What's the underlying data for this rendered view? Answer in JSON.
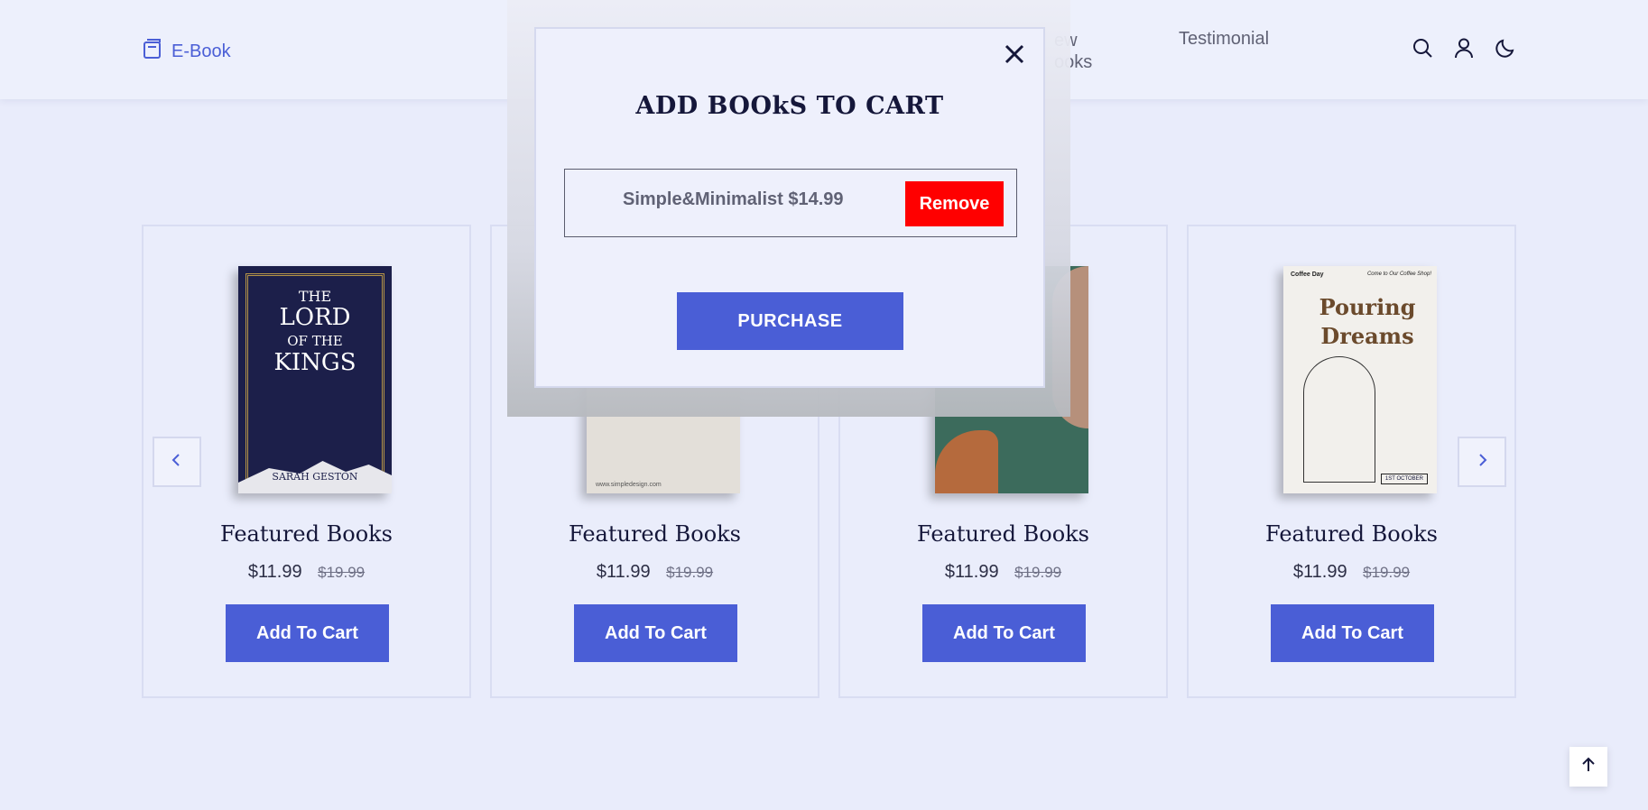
{
  "header": {
    "logo_label": "E-Book",
    "nav_partial_line1": "ew",
    "nav_partial_line2": "ooks",
    "nav_testimonial": "Testimonial",
    "icons": [
      "search-icon",
      "user-icon",
      "moon-icon"
    ]
  },
  "modal": {
    "title": "ADD BOOkS TO CART",
    "item_text": "Simple&Minimalist $14.99",
    "remove_label": "Remove",
    "purchase_label": "PURCHASE"
  },
  "cards": [
    {
      "title": "Featured Books",
      "price": "$11.99",
      "old_price": "$19.99",
      "button": "Add To Cart",
      "cover": {
        "line1": "THE",
        "line2": "LORD",
        "line3": "OF THE",
        "line4": "KINGS",
        "author": "SARAH GESTON"
      }
    },
    {
      "title": "Featured Books",
      "price": "$11.99",
      "old_price": "$19.99",
      "button": "Add To Cart",
      "cover": {
        "url": "www.simpledesign.com"
      }
    },
    {
      "title": "Featured Books",
      "price": "$11.99",
      "old_price": "$19.99",
      "button": "Add To Cart"
    },
    {
      "title": "Featured Books",
      "price": "$11.99",
      "old_price": "$19.99",
      "button": "Add To Cart",
      "cover": {
        "top_left": "Coffee Day",
        "top_right": "Come to Our Coffee Shop!",
        "headline1": "Pouring",
        "headline2": "Dreams",
        "date": "1ST OCTOBER"
      }
    }
  ],
  "colors": {
    "accent": "#4a5ed6",
    "remove": "#ff0000",
    "background": "#e9ecfb"
  }
}
